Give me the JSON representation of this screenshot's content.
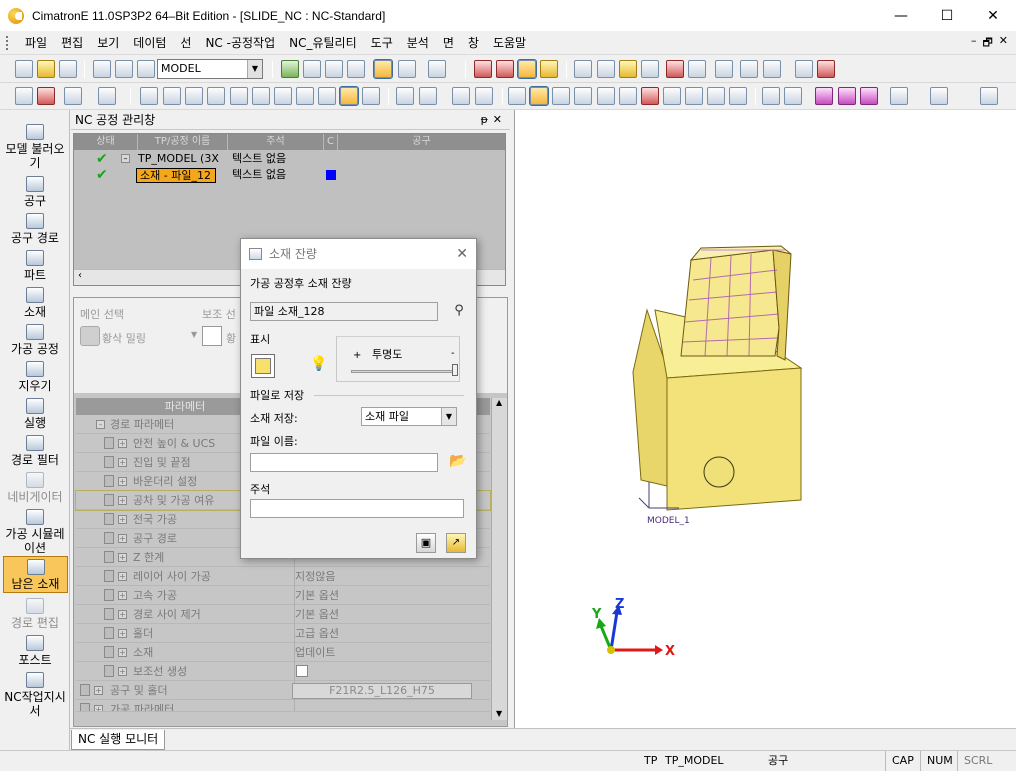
{
  "window": {
    "title": "CimatronE 11.0SP3P2 64–Bit Edition - [SLIDE_NC : NC-Standard]",
    "minimize": "—",
    "maximize": "☐",
    "close": "✕"
  },
  "menu": {
    "items": [
      "파일",
      "편집",
      "보기",
      "데이텀",
      "선",
      "NC -공정작업",
      "NC_유틸리티",
      "도구",
      "분석",
      "면",
      "창",
      "도움말"
    ],
    "mdi": [
      "–",
      "🗗",
      "✕"
    ]
  },
  "toolbar1": {
    "model_combo": "MODEL"
  },
  "sidebar": {
    "items": [
      {
        "label": "모델 불러오기"
      },
      {
        "label": "공구"
      },
      {
        "label": "공구 경로"
      },
      {
        "label": "파트"
      },
      {
        "label": "소재"
      },
      {
        "label": "가공 공정"
      },
      {
        "label": "지우기"
      },
      {
        "label": "실행"
      },
      {
        "label": "경로 필터"
      },
      {
        "label": "네비게이터"
      },
      {
        "label": "가공 시뮬레이션"
      },
      {
        "label": "남은 소재"
      },
      {
        "label": "경로 편집"
      },
      {
        "label": "포스트"
      },
      {
        "label": "NC작업지시서"
      }
    ]
  },
  "process_manager": {
    "title": "NC 공정 관리창",
    "pin": "ᵽ",
    "close": "✕",
    "columns": [
      "상태",
      "TP/공정 이름",
      "주석",
      "C",
      "공구"
    ],
    "rows": [
      {
        "name": "TP_MODEL (3X",
        "note": "텍스트 없음"
      },
      {
        "name": "소재 - 파일_12",
        "note": "텍스트 없음"
      }
    ]
  },
  "selection": {
    "main_label": "메인 선택",
    "main_value": "황삭 밀링",
    "sub_label": "보조 선",
    "sub_value": "황"
  },
  "params": {
    "header": "파라메터",
    "rows": [
      {
        "name": "경로 파라메터",
        "value": ""
      },
      {
        "name": "안전 높이 & UCS",
        "value": ""
      },
      {
        "name": "진입 및 끝점",
        "value": ""
      },
      {
        "name": "바운더리 설정",
        "value": ""
      },
      {
        "name": "공차 및 가공 여유",
        "value": ""
      },
      {
        "name": "전국 가공",
        "value": ""
      },
      {
        "name": "공구 경로",
        "value": ""
      },
      {
        "name": "Z 한계",
        "value": ""
      },
      {
        "name": "레이어 사이 가공",
        "value": "지정않음"
      },
      {
        "name": "고속 가공",
        "value": "기본 옵션"
      },
      {
        "name": "경로 사이 제거",
        "value": "기본 옵션"
      },
      {
        "name": "홀더",
        "value": "고급 옵션"
      },
      {
        "name": "소재",
        "value": "업데이트"
      },
      {
        "name": "보조선 생성",
        "value": ""
      },
      {
        "name": "공구 및 홀더",
        "value": ""
      },
      {
        "name": "가공 파라메터",
        "value": ""
      }
    ],
    "tool_value": "F21R2.5_L126_H75"
  },
  "dialog": {
    "title": "소재 잔량",
    "subtitle": "가공 공정후 소재 잔량",
    "stock_name": "파일 소재_128",
    "display_label": "표시",
    "transparency_label": "투명도",
    "plus": "+",
    "minus": "-",
    "save_section": "파일로 저장",
    "save_stock_label": "소재 저장:",
    "save_stock_value": "소재 파일",
    "file_name_label": "파일 이름:",
    "file_name_value": "",
    "comment_label": "주석",
    "comment_value": "",
    "color": "#f7e06c"
  },
  "viewport": {
    "model_label": "MODEL_1",
    "axis_x": "X",
    "axis_y": "Y",
    "axis_z": "Z"
  },
  "tabs": {
    "nc_monitor": "NC 실행 모니터"
  },
  "status": {
    "tp": "TP",
    "tp_name": "TP_MODEL",
    "tool": "공구",
    "cap": "CAP",
    "num": "NUM",
    "scrl": "SCRL"
  }
}
